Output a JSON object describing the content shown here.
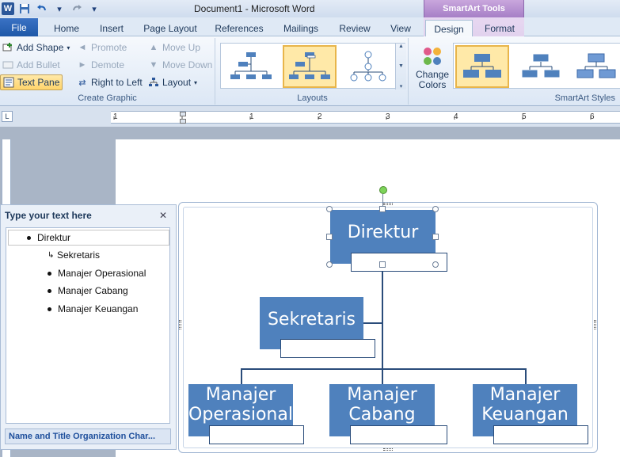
{
  "window": {
    "title": "Document1  -  Microsoft Word",
    "contextual_tools": "SmartArt Tools"
  },
  "quick_access": {
    "icons": [
      "word-logo",
      "save-icon",
      "undo-icon",
      "redo-icon",
      "customize-icon"
    ]
  },
  "tabs": {
    "file": "File",
    "items": [
      "Home",
      "Insert",
      "Page Layout",
      "References",
      "Mailings",
      "Review",
      "View"
    ],
    "contextual": [
      "Design",
      "Format"
    ],
    "active": "Design"
  },
  "ribbon": {
    "create_graphic": {
      "label": "Create Graphic",
      "add_shape": "Add Shape",
      "add_bullet": "Add Bullet",
      "text_pane": "Text Pane",
      "promote": "Promote",
      "demote": "Demote",
      "right_to_left": "Right to Left",
      "move_up": "Move Up",
      "move_down": "Move Down",
      "layout": "Layout"
    },
    "layouts": {
      "label": "Layouts"
    },
    "change_colors": {
      "line1": "Change",
      "line2": "Colors"
    },
    "styles": {
      "label": "SmartArt Styles"
    }
  },
  "ruler": {
    "numbers": [
      "1",
      "1",
      "2",
      "3",
      "4",
      "5",
      "6"
    ]
  },
  "text_pane": {
    "title": "Type your text here",
    "items": [
      {
        "text": "Direktur",
        "level": 1
      },
      {
        "text": "Sekretaris",
        "level": "assistant"
      },
      {
        "text": "Manajer Operasional",
        "level": 2
      },
      {
        "text": "Manajer Cabang",
        "level": 2
      },
      {
        "text": "Manajer Keuangan",
        "level": 2
      }
    ],
    "footer": "Name and Title Organization Char..."
  },
  "smartart": {
    "nodes": {
      "direktur": "Direktur",
      "sekretaris": "Sekretaris",
      "operasional": "Manajer Operasional",
      "cabang": "Manajer Cabang",
      "keuangan": "Manajer Keuangan"
    },
    "colors": {
      "node_fill": "#4f81bd",
      "connector": "#2a4c7a"
    }
  }
}
